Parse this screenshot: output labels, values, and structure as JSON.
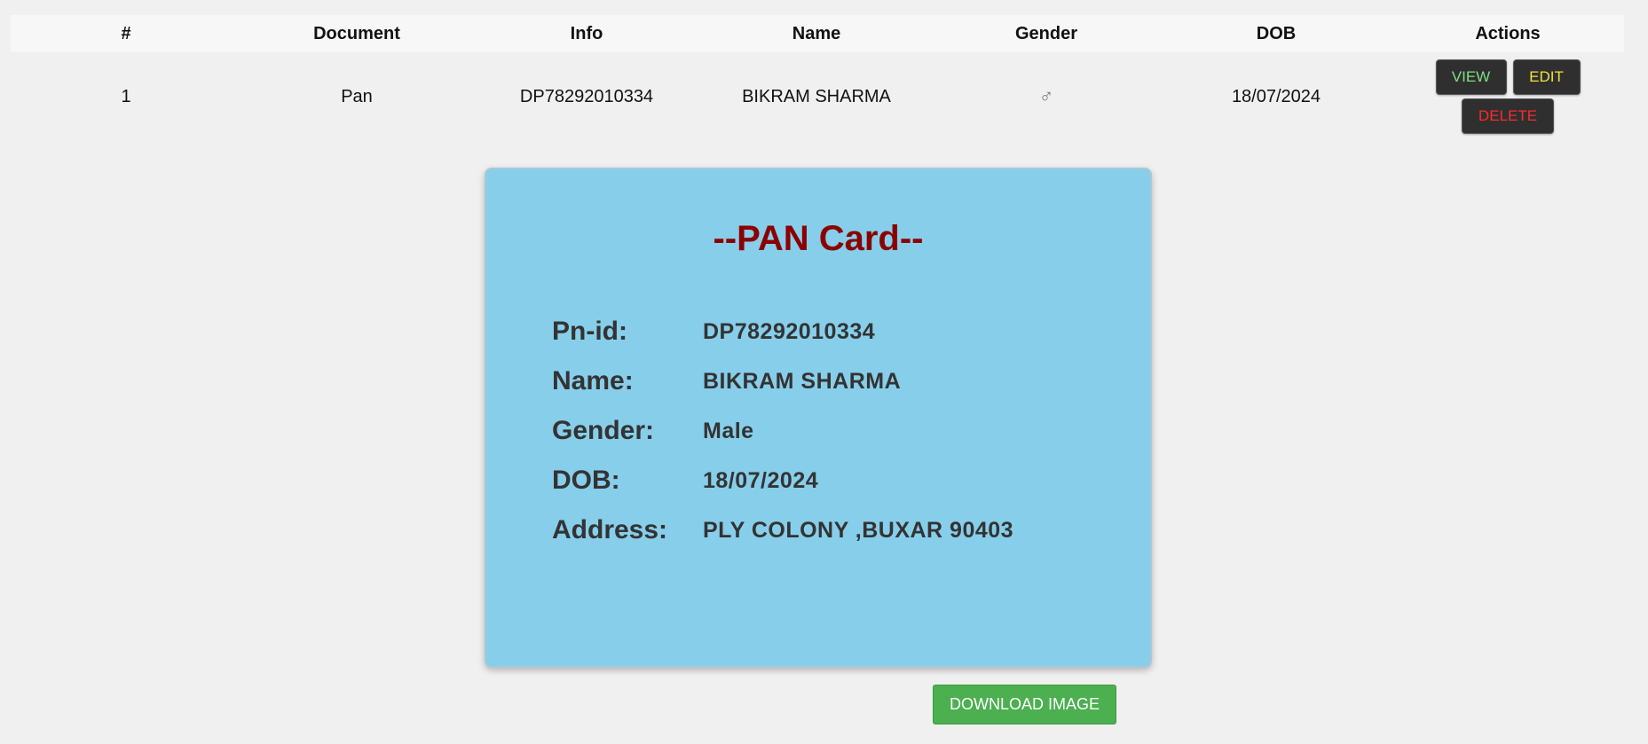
{
  "table": {
    "headers": [
      "#",
      "Document",
      "Info",
      "Name",
      "Gender",
      "DOB",
      "Actions"
    ],
    "rows": [
      {
        "index": "1",
        "document": "Pan",
        "info": "DP78292010334",
        "name": "BIKRAM SHARMA",
        "gender_symbol": "♂",
        "dob": "18/07/2024",
        "actions": {
          "view": "VIEW",
          "edit": "EDIT",
          "delete": "DELETE"
        }
      }
    ]
  },
  "card": {
    "title": "--PAN Card--",
    "fields": [
      {
        "label": "Pn-id:",
        "value": "DP78292010334"
      },
      {
        "label": "Name:",
        "value": "BIKRAM SHARMA"
      },
      {
        "label": "Gender:",
        "value": "Male"
      },
      {
        "label": "DOB:",
        "value": "18/07/2024"
      },
      {
        "label": "Address:",
        "value": "PLY COLONY ,BUXAR 90403"
      }
    ]
  },
  "download_button": "DOWNLOAD IMAGE",
  "colors": {
    "card_background": "#87ceeb",
    "card_title": "#8b0000",
    "view_text": "#7ee07e",
    "edit_text": "#f2e23a",
    "delete_text": "#ff2a2a",
    "download_background": "#4caf50"
  },
  "icons": {
    "gender": "male-symbol-icon"
  }
}
